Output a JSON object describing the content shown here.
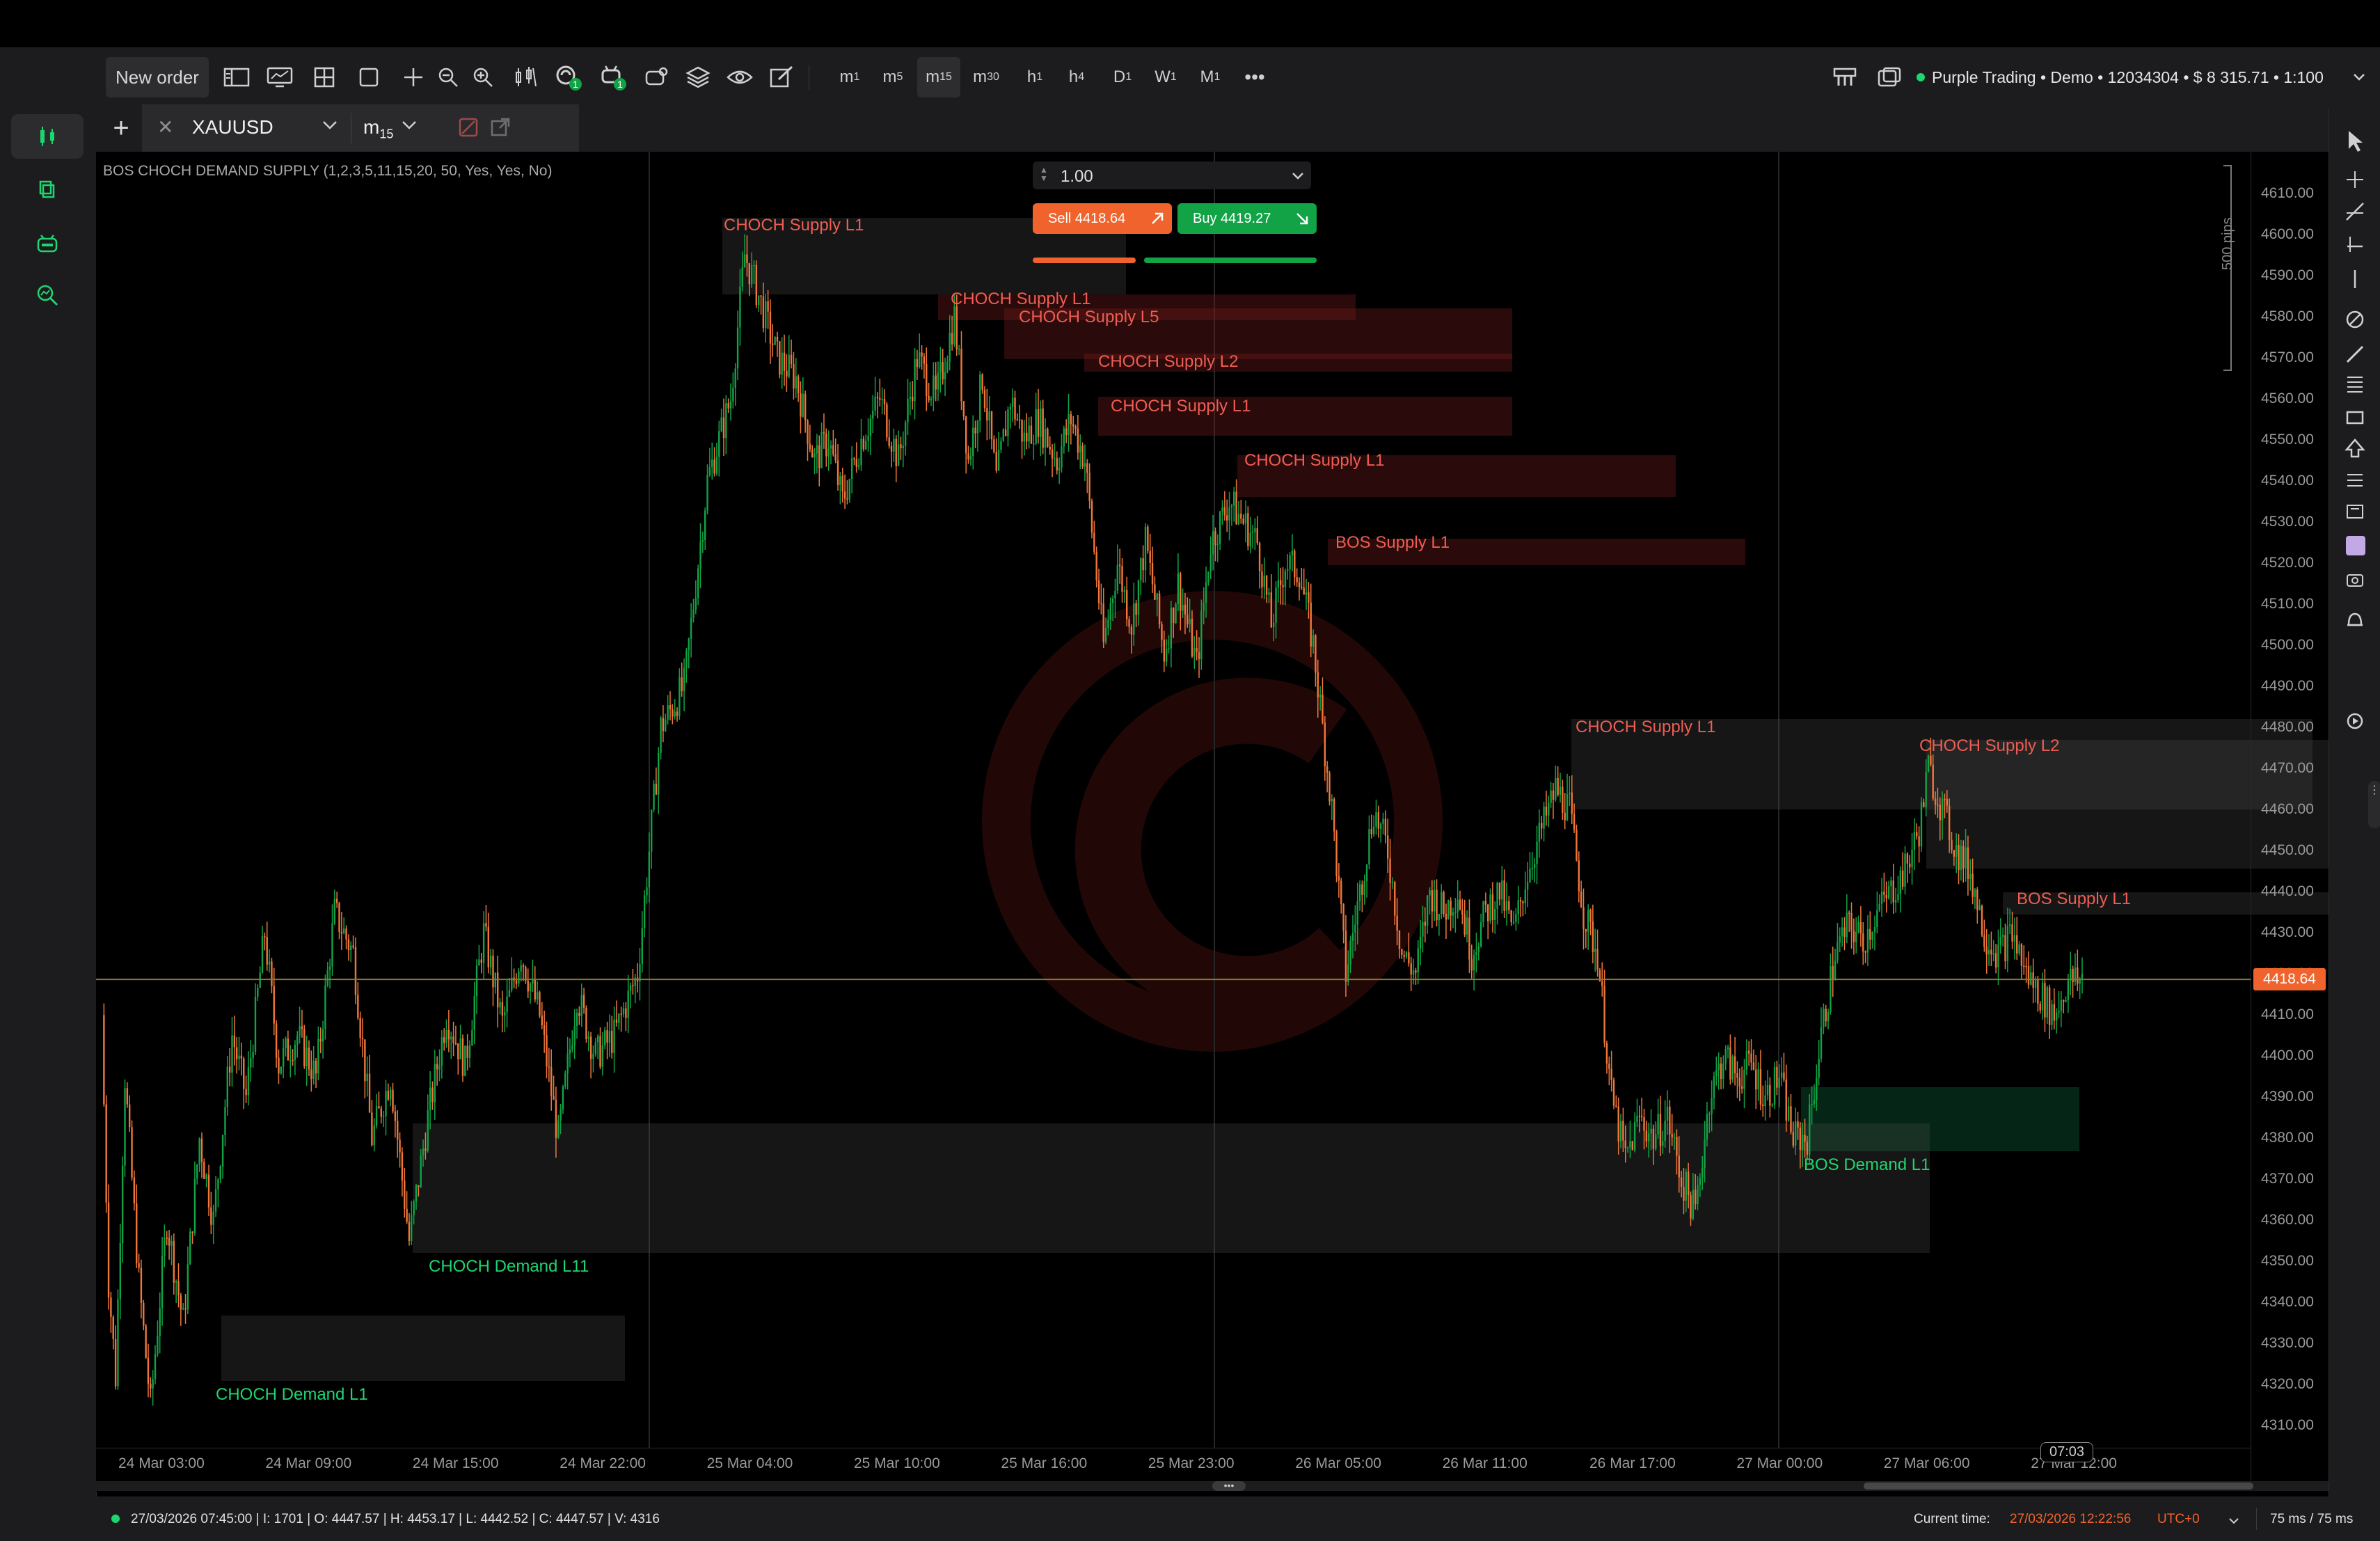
{
  "toolbar": {
    "new_order": "New order",
    "timeframes": [
      {
        "label": "m",
        "sub": "1",
        "active": false
      },
      {
        "label": "m",
        "sub": "5",
        "active": false
      },
      {
        "label": "m",
        "sub": "15",
        "active": true
      },
      {
        "label": "m",
        "sub": "30",
        "active": false
      },
      {
        "label": "h",
        "sub": "1",
        "active": false
      },
      {
        "label": "h",
        "sub": "4",
        "active": false
      },
      {
        "label": "D",
        "sub": "1",
        "active": false
      },
      {
        "label": "W",
        "sub": "1",
        "active": false
      },
      {
        "label": "M",
        "sub": "1",
        "active": false
      }
    ],
    "more": "•••",
    "badge_1": "1",
    "badge_2": "1",
    "account": "Purple Trading • Demo • 12034304 • $ 8 315.71 • 1:100",
    "status_color": "#1ed66f"
  },
  "tab": {
    "add": "+",
    "close": "✕",
    "symbol": "XAUUSD",
    "timeframe": "m",
    "timeframe_sub": "15"
  },
  "indicator": {
    "label": "BOS CHOCH DEMAND SUPPLY (1,2,3,5,11,15,20, 50, Yes, Yes, No)"
  },
  "trade_panel": {
    "volume": "1.00",
    "sell_label": "Sell 4418.64",
    "buy_label": "Buy 4419.27",
    "sell_color": "#f0632c",
    "buy_color": "#11a346"
  },
  "pips_label": "500 pips",
  "current_price_label": "4418.64",
  "timer_label": "07:03",
  "zones": [
    {
      "kind": "supply",
      "text": "CHOCH Supply L1"
    },
    {
      "kind": "supply",
      "text": "CHOCH Supply L1"
    },
    {
      "kind": "supply",
      "text": "CHOCH Supply L5"
    },
    {
      "kind": "supply",
      "text": "CHOCH Supply L2"
    },
    {
      "kind": "supply",
      "text": "CHOCH Supply L1"
    },
    {
      "kind": "supply",
      "text": "CHOCH Supply L1"
    },
    {
      "kind": "supply",
      "text": "BOS Supply L1"
    },
    {
      "kind": "supply",
      "text": "CHOCH Supply L1"
    },
    {
      "kind": "supply",
      "text": "CHOCH Supply L2"
    },
    {
      "kind": "supply",
      "text": "BOS Supply L1"
    },
    {
      "kind": "demand",
      "text": "BOS Demand L1"
    },
    {
      "kind": "demand",
      "text": "CHOCH Demand L11"
    },
    {
      "kind": "demand",
      "text": "CHOCH Demand L1"
    }
  ],
  "price_axis": [
    "4610.00",
    "4600.00",
    "4590.00",
    "4580.00",
    "4570.00",
    "4560.00",
    "4550.00",
    "4540.00",
    "4530.00",
    "4520.00",
    "4510.00",
    "4500.00",
    "4490.00",
    "4480.00",
    "4470.00",
    "4460.00",
    "4450.00",
    "4440.00",
    "4430.00",
    "4420.00",
    "4410.00",
    "4400.00",
    "4390.00",
    "4380.00",
    "4370.00",
    "4360.00",
    "4350.00",
    "4340.00",
    "4330.00",
    "4320.00",
    "4310.00"
  ],
  "time_axis": [
    "24 Mar 03:00",
    "24 Mar 09:00",
    "24 Mar 15:00",
    "24 Mar 22:00",
    "25 Mar 04:00",
    "25 Mar 10:00",
    "25 Mar 16:00",
    "25 Mar 23:00",
    "26 Mar 05:00",
    "26 Mar 11:00",
    "26 Mar 17:00",
    "27 Mar 00:00",
    "27 Mar 06:00",
    "27 Mar 12:00"
  ],
  "status": {
    "ohlc": "27/03/2026 07:45:00 | I: 1701 | O: 4447.57 | H: 4453.17 | L: 4442.52 | C: 4447.57 | V: 4316",
    "current_time_label": "Current time:",
    "current_time": "27/03/2026 12:22:56",
    "timezone": "UTC+0",
    "latency": "75 ms / 75 ms"
  },
  "colors": {
    "bull": "#11a346",
    "bear": "#f0773a",
    "supply_text": "#ef5d53",
    "demand_text": "#1ed66f",
    "price_line": "#8a7a2a"
  },
  "chart_data": {
    "type": "candlestick",
    "symbol": "XAUUSD",
    "timeframe": "m15",
    "ylim": [
      4305,
      4615
    ],
    "current_price": 4418.64,
    "swing_path": [
      [
        0,
        4410
      ],
      [
        3,
        4345
      ],
      [
        6,
        4322
      ],
      [
        10,
        4395
      ],
      [
        16,
        4345
      ],
      [
        21,
        4315
      ],
      [
        28,
        4360
      ],
      [
        35,
        4335
      ],
      [
        42,
        4380
      ],
      [
        48,
        4360
      ],
      [
        56,
        4405
      ],
      [
        62,
        4390
      ],
      [
        70,
        4430
      ],
      [
        76,
        4398
      ],
      [
        84,
        4405
      ],
      [
        92,
        4395
      ],
      [
        100,
        4435
      ],
      [
        108,
        4425
      ],
      [
        116,
        4380
      ],
      [
        124,
        4395
      ],
      [
        132,
        4355
      ],
      [
        140,
        4385
      ],
      [
        148,
        4410
      ],
      [
        156,
        4398
      ],
      [
        164,
        4430
      ],
      [
        172,
        4408
      ],
      [
        180,
        4425
      ],
      [
        188,
        4410
      ],
      [
        196,
        4380
      ],
      [
        204,
        4415
      ],
      [
        212,
        4400
      ],
      [
        220,
        4405
      ],
      [
        230,
        4420
      ],
      [
        240,
        4480
      ],
      [
        250,
        4490
      ],
      [
        260,
        4540
      ],
      [
        270,
        4560
      ],
      [
        276,
        4595
      ],
      [
        282,
        4585
      ],
      [
        290,
        4570
      ],
      [
        298,
        4565
      ],
      [
        306,
        4545
      ],
      [
        312,
        4550
      ],
      [
        318,
        4535
      ],
      [
        326,
        4550
      ],
      [
        334,
        4560
      ],
      [
        342,
        4545
      ],
      [
        350,
        4570
      ],
      [
        358,
        4560
      ],
      [
        366,
        4580
      ],
      [
        372,
        4545
      ],
      [
        378,
        4565
      ],
      [
        384,
        4540
      ],
      [
        390,
        4560
      ],
      [
        396,
        4550
      ],
      [
        402,
        4555
      ],
      [
        410,
        4545
      ],
      [
        416,
        4555
      ],
      [
        422,
        4545
      ],
      [
        430,
        4500
      ],
      [
        436,
        4520
      ],
      [
        442,
        4505
      ],
      [
        448,
        4525
      ],
      [
        456,
        4498
      ],
      [
        462,
        4515
      ],
      [
        470,
        4495
      ],
      [
        476,
        4525
      ],
      [
        484,
        4535
      ],
      [
        490,
        4530
      ],
      [
        496,
        4525
      ],
      [
        502,
        4505
      ],
      [
        508,
        4520
      ],
      [
        514,
        4518
      ],
      [
        520,
        4500
      ],
      [
        528,
        4460
      ],
      [
        534,
        4420
      ],
      [
        540,
        4440
      ],
      [
        546,
        4460
      ],
      [
        552,
        4450
      ],
      [
        558,
        4425
      ],
      [
        564,
        4420
      ],
      [
        570,
        4440
      ],
      [
        576,
        4435
      ],
      [
        582,
        4440
      ],
      [
        588,
        4425
      ],
      [
        594,
        4435
      ],
      [
        600,
        4440
      ],
      [
        606,
        4430
      ],
      [
        612,
        4445
      ],
      [
        618,
        4455
      ],
      [
        624,
        4465
      ],
      [
        630,
        4460
      ],
      [
        636,
        4435
      ],
      [
        642,
        4425
      ],
      [
        648,
        4390
      ],
      [
        654,
        4375
      ],
      [
        660,
        4385
      ],
      [
        666,
        4380
      ],
      [
        672,
        4385
      ],
      [
        678,
        4370
      ],
      [
        684,
        4362
      ],
      [
        690,
        4390
      ],
      [
        696,
        4400
      ],
      [
        702,
        4395
      ],
      [
        708,
        4398
      ],
      [
        714,
        4390
      ],
      [
        720,
        4395
      ],
      [
        726,
        4380
      ],
      [
        732,
        4380
      ],
      [
        738,
        4405
      ],
      [
        744,
        4425
      ],
      [
        750,
        4432
      ],
      [
        756,
        4428
      ],
      [
        762,
        4435
      ],
      [
        768,
        4440
      ],
      [
        774,
        4445
      ],
      [
        780,
        4455
      ],
      [
        784,
        4470
      ],
      [
        790,
        4460
      ],
      [
        796,
        4450
      ],
      [
        802,
        4445
      ],
      [
        808,
        4430
      ],
      [
        814,
        4425
      ],
      [
        820,
        4430
      ],
      [
        826,
        4420
      ],
      [
        832,
        4415
      ],
      [
        838,
        4410
      ],
      [
        844,
        4418
      ],
      [
        850,
        4418.64
      ]
    ]
  }
}
